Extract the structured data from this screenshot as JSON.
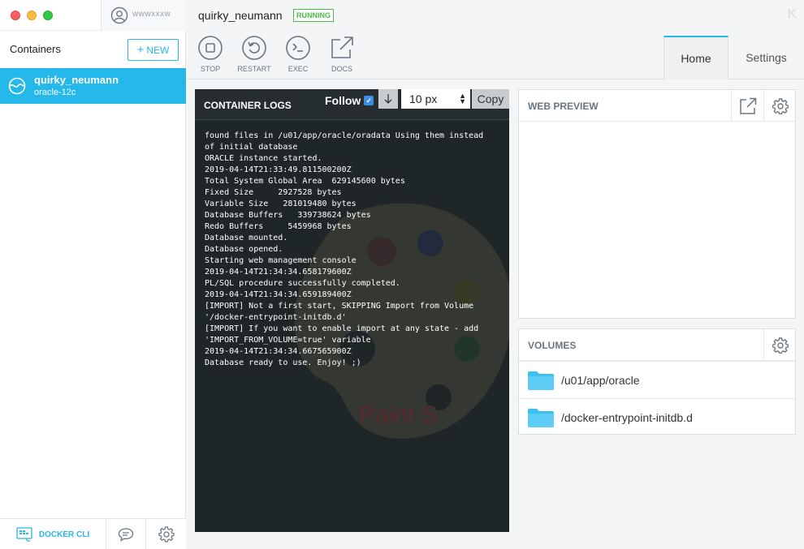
{
  "sidebar": {
    "user_name": "wwwxxxw",
    "title": "Containers",
    "new_button": "NEW",
    "containers": [
      {
        "name": "quirky_neumann",
        "image": "oracle-12c"
      }
    ],
    "footer": {
      "docker_cli": "DOCKER CLI"
    }
  },
  "header": {
    "container_name": "quirky_neumann",
    "status": "RUNNING",
    "actions": [
      {
        "label": "STOP",
        "icon": "stop-icon"
      },
      {
        "label": "RESTART",
        "icon": "restart-icon"
      },
      {
        "label": "EXEC",
        "icon": "terminal-icon"
      },
      {
        "label": "DOCS",
        "icon": "external-link-icon"
      }
    ],
    "tabs": [
      {
        "label": "Home",
        "active": true
      },
      {
        "label": "Settings",
        "active": false
      }
    ],
    "logo": "K"
  },
  "logs": {
    "title": "CONTAINER LOGS",
    "follow_label": "Follow",
    "follow_checked": true,
    "font_size_option": "10 px",
    "copy_label": "Copy",
    "watermark": "Paint S",
    "lines": "found files in /u01/app/oracle/oradata Using them instead\nof initial database\nORACLE instance started.\n2019-04-14T21:33:49.811500200Z\nTotal System Global Area  629145600 bytes\nFixed Size     2927528 bytes\nVariable Size   281019480 bytes\nDatabase Buffers   339738624 bytes\nRedo Buffers     5459968 bytes\nDatabase mounted.\nDatabase opened.\nStarting web management console\n2019-04-14T21:34:34.658179600Z\nPL/SQL procedure successfully completed.\n2019-04-14T21:34:34.659189400Z\n[IMPORT] Not a first start, SKIPPING Import from Volume\n'/docker-entrypoint-initdb.d'\n[IMPORT] If you want to enable import at any state - add\n'IMPORT_FROM_VOLUME=true' variable\n2019-04-14T21:34:34.667565900Z\nDatabase ready to use. Enjoy! ;)"
  },
  "web_preview": {
    "title": "WEB PREVIEW"
  },
  "volumes": {
    "title": "VOLUMES",
    "items": [
      {
        "path": "/u01/app/oracle"
      },
      {
        "path": "/docker-entrypoint-initdb.d"
      }
    ]
  },
  "colors": {
    "accent": "#24b8eb",
    "running": "#4cb84c",
    "log_bg": "#1f2628"
  }
}
